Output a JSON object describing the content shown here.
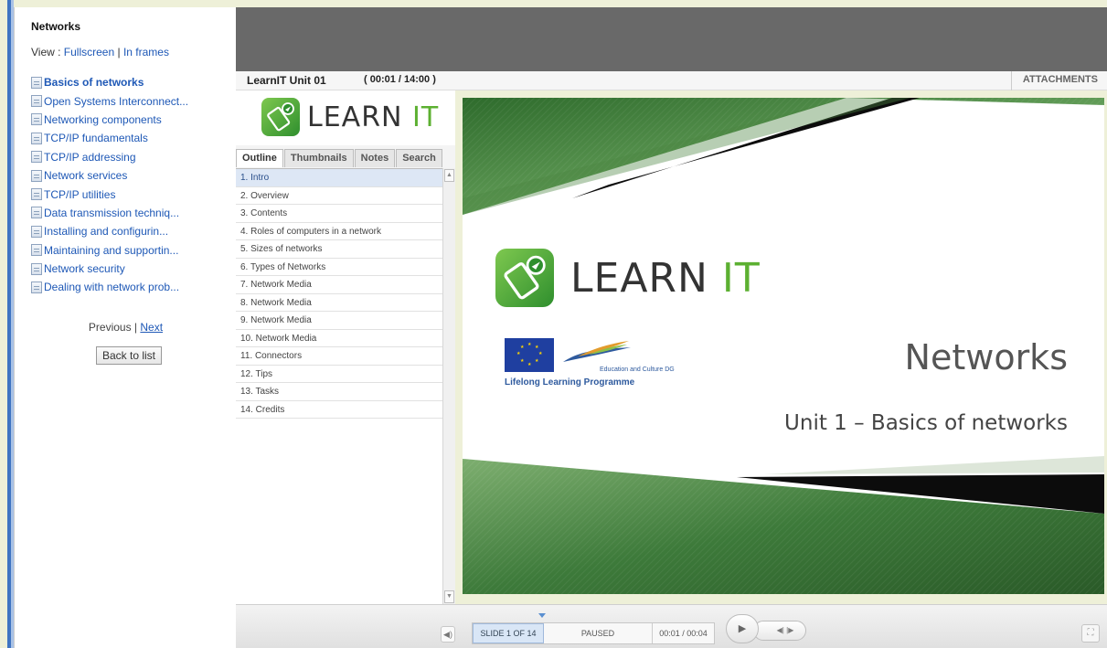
{
  "sidebar": {
    "heading": "Networks",
    "view_prefix": "View : ",
    "view_fullscreen": "Fullscreen",
    "view_sep": " | ",
    "view_frames": "In frames",
    "items": [
      {
        "label": "Basics of networks"
      },
      {
        "label": "Open Systems Interconnect..."
      },
      {
        "label": "Networking components"
      },
      {
        "label": "TCP/IP fundamentals"
      },
      {
        "label": "TCP/IP addressing"
      },
      {
        "label": "Network services"
      },
      {
        "label": "TCP/IP utilities"
      },
      {
        "label": "Data transmission techniq..."
      },
      {
        "label": "Installing and configurin..."
      },
      {
        "label": "Maintaining and supportin..."
      },
      {
        "label": "Network security"
      },
      {
        "label": "Dealing with network prob..."
      }
    ],
    "previous": "Previous",
    "pn_sep": " | ",
    "next": "Next",
    "back_label": "Back to list"
  },
  "player": {
    "title": "LearnIT Unit 01",
    "time": "( 00:01 / 14:00 )",
    "attachments": "ATTACHMENTS",
    "tabs": [
      "Outline",
      "Thumbnails",
      "Notes",
      "Search"
    ],
    "outline": [
      "1. Intro",
      "2. Overview",
      "3. Contents",
      "4. Roles of computers in a network",
      "5. Sizes of networks",
      "6. Types of Networks",
      "7. Network Media",
      "8. Network Media",
      "9. Network Media",
      "10. Network Media",
      "11. Connectors",
      "12. Tips",
      "13. Tasks",
      "14. Credits"
    ]
  },
  "logo": {
    "learn": "LEARN ",
    "it": "IT"
  },
  "slide": {
    "title": "Networks",
    "subtitle": "Unit 1 – Basics of networks",
    "edu_text": "Education and Culture DG",
    "lll_text": "Lifelong Learning Programme"
  },
  "controls": {
    "slide_count": "SLIDE 1 OF 14",
    "state": "PAUSED",
    "time": "00:01 / 00:04"
  },
  "colors": {
    "accent_green": "#5cb031",
    "link_blue": "#1e58b6",
    "topbar_gray": "#696969"
  }
}
